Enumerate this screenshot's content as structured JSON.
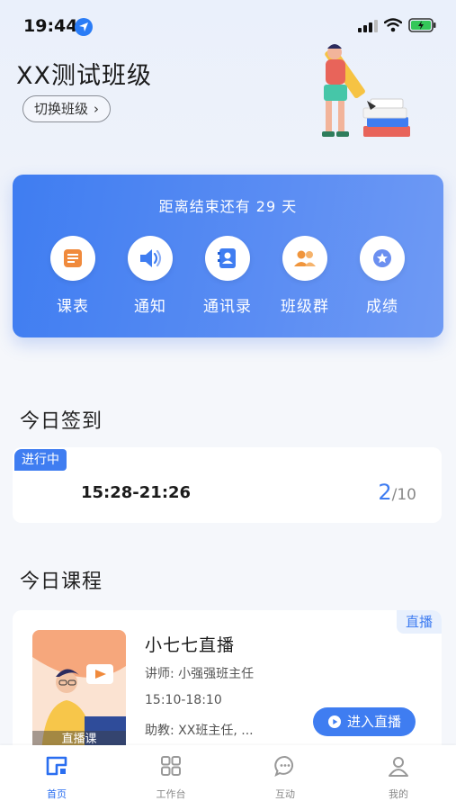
{
  "status_bar": {
    "time": "19:44"
  },
  "header": {
    "class_name": "XX测试班级",
    "switch_class_label": "切换班级",
    "switch_chevron": "›"
  },
  "summary_card": {
    "countdown_text": "距离结束还有 29 天",
    "quick_actions": [
      {
        "label": "课表",
        "icon": "schedule-icon",
        "color": "#f08a3c"
      },
      {
        "label": "通知",
        "icon": "speaker-icon",
        "color": "#3f7df1"
      },
      {
        "label": "通讯录",
        "icon": "contacts-icon",
        "color": "#3f7df1"
      },
      {
        "label": "班级群",
        "icon": "group-icon",
        "color": "#f0953c"
      },
      {
        "label": "成绩",
        "icon": "star-badge-icon",
        "color": "#6b8ff0"
      }
    ]
  },
  "signin": {
    "section_title": "今日签到",
    "status_badge": "进行中",
    "time_range": "15:28-21:26",
    "count": "2",
    "total": "/10"
  },
  "courses": {
    "section_title": "今日课程",
    "items": [
      {
        "tag": "直播",
        "thumb_caption": "直播课",
        "name": "小七七直播",
        "teacher": "讲师: 小强强班主任",
        "time": "15:10-18:10",
        "assistant": "助教: XX班主任, ...",
        "enter_label": "进入直播"
      }
    ]
  },
  "tab_bar": {
    "items": [
      {
        "label": "首页",
        "active": true
      },
      {
        "label": "工作台",
        "active": false
      },
      {
        "label": "互动",
        "active": false
      },
      {
        "label": "我的",
        "active": false
      }
    ]
  },
  "colors": {
    "accent": "#3f7df1",
    "card_bg": "#ffffff",
    "page_bg": "#f5f7fb"
  }
}
